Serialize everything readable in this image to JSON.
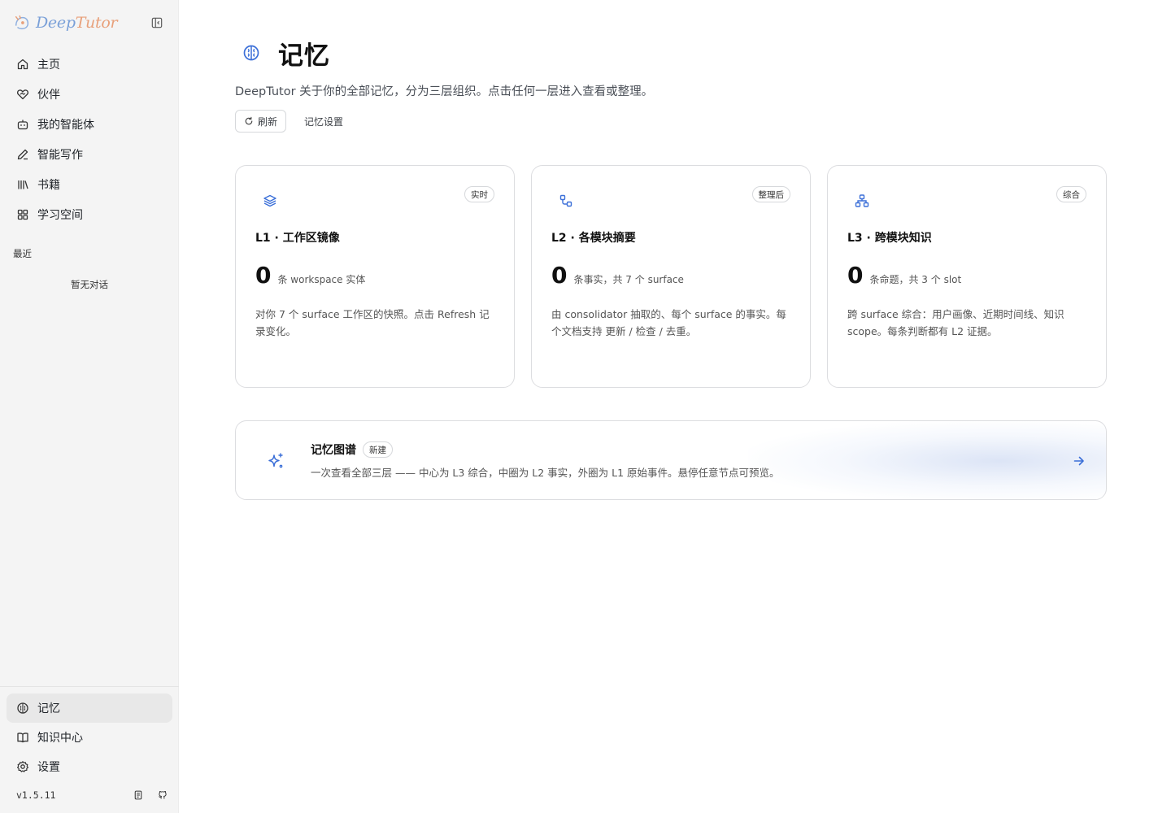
{
  "brand": {
    "part1": "Deep",
    "part2": "Tutor"
  },
  "sidebar": {
    "items": [
      {
        "label": "主页",
        "icon": "home-icon"
      },
      {
        "label": "伙伴",
        "icon": "heart-handshake-icon"
      },
      {
        "label": "我的智能体",
        "icon": "bot-icon"
      },
      {
        "label": "智能写作",
        "icon": "pen-icon"
      },
      {
        "label": "书籍",
        "icon": "library-icon"
      },
      {
        "label": "学习空间",
        "icon": "grid-icon"
      }
    ],
    "recent_label": "最近",
    "recent_empty": "暂无对话",
    "bottom_items": [
      {
        "label": "记忆",
        "icon": "brain-icon",
        "active": true
      },
      {
        "label": "知识中心",
        "icon": "book-open-icon"
      },
      {
        "label": "设置",
        "icon": "gear-icon"
      }
    ],
    "version": "v1.5.11"
  },
  "page": {
    "title": "记忆",
    "subtitle": "DeepTutor 关于你的全部记忆，分为三层组织。点击任何一层进入查看或整理。",
    "refresh_label": "刷新",
    "settings_label": "记忆设置"
  },
  "cards": [
    {
      "icon": "layers-icon",
      "badge": "实时",
      "title": "L1 · 工作区镜像",
      "count": "0",
      "unit": "条 workspace 实体",
      "desc": "对你 7 个 surface 工作区的快照。点击 Refresh 记录变化。"
    },
    {
      "icon": "workflow-icon",
      "badge": "整理后",
      "title": "L2 · 各模块摘要",
      "count": "0",
      "unit": "条事实，共 7 个 surface",
      "desc": "由 consolidator 抽取的、每个 surface 的事实。每个文档支持 更新 / 检查 / 去重。"
    },
    {
      "icon": "network-icon",
      "badge": "综合",
      "title": "L3 · 跨模块知识",
      "count": "0",
      "unit": "条命题，共 3 个 slot",
      "desc": "跨 surface 综合：用户画像、近期时间线、知识 scope。每条判断都有 L2 证据。"
    }
  ],
  "graph": {
    "title": "记忆图谱",
    "badge": "新建",
    "desc": "一次查看全部三层 —— 中心为 L3 综合，中圈为 L2 事实，外圈为 L1 原始事件。悬停任意节点可预览。",
    "icon": "sparkles-icon"
  },
  "colors": {
    "accent": "#3b6fd8",
    "sidebar_bg": "#f4f4f4",
    "active_bg": "#e8e8e8"
  }
}
